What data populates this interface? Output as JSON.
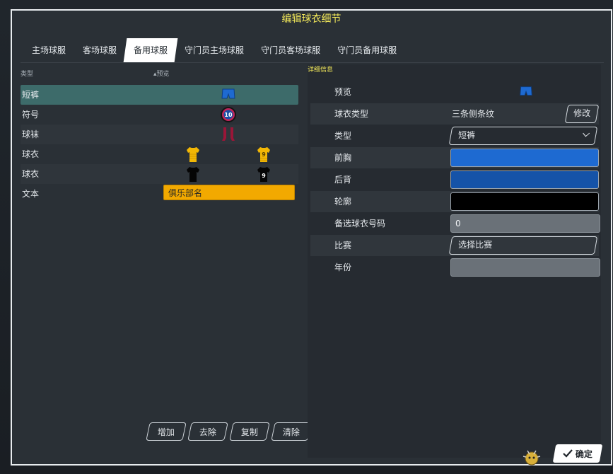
{
  "dialog": {
    "title": "编辑球衣细节"
  },
  "tabs": [
    {
      "label": "主场球服",
      "active": false
    },
    {
      "label": "客场球服",
      "active": false
    },
    {
      "label": "备用球服",
      "active": true
    },
    {
      "label": "守门员主场球服",
      "active": false
    },
    {
      "label": "守门员客场球服",
      "active": false
    },
    {
      "label": "守门员备用球服",
      "active": false
    }
  ],
  "left": {
    "col_type": "类型",
    "col_preview": "▴预览",
    "rows": [
      {
        "label": "短裤",
        "selected": true
      },
      {
        "label": "符号",
        "badge_number": "10"
      },
      {
        "label": "球袜"
      },
      {
        "label": "球衣",
        "shirt_number": "9"
      },
      {
        "label": "球衣",
        "shirt_number": "9"
      },
      {
        "label": "文本",
        "text_value": "俱乐部名"
      }
    ],
    "buttons": {
      "add": "增加",
      "remove": "去除",
      "copy": "复制",
      "clear": "清除"
    }
  },
  "details": {
    "header": "详细信息",
    "preview_label": "预览",
    "kit_type_label": "球衣类型",
    "kit_type_value": "三条侧条纹",
    "modify_button": "修改",
    "type_label": "类型",
    "type_value": "短裤",
    "front_label": "前胸",
    "back_label": "后背",
    "outline_label": "轮廓",
    "alt_number_label": "备选球衣号码",
    "alt_number_value": "0",
    "match_label": "比赛",
    "match_button": "选择比赛",
    "year_label": "年份",
    "year_value": ""
  },
  "colors": {
    "front": "#1e6ad1",
    "back": "#1553a8",
    "outline": "#000000",
    "accent": "#f2e85a",
    "selected_row": "#3d6b6a",
    "kit_yellow": "#f2b705"
  },
  "footer": {
    "ok_button": "确定"
  }
}
